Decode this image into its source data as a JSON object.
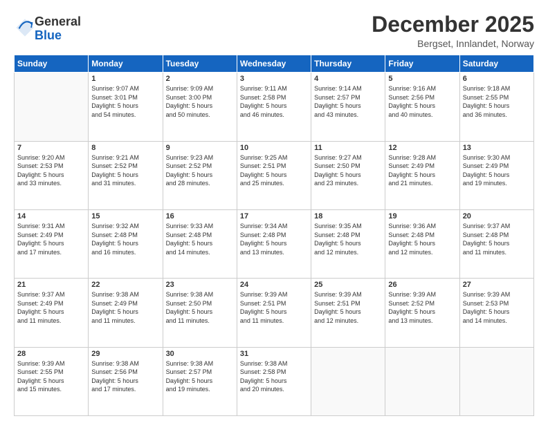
{
  "logo": {
    "general": "General",
    "blue": "Blue"
  },
  "title": "December 2025",
  "location": "Bergset, Innlandet, Norway",
  "headers": [
    "Sunday",
    "Monday",
    "Tuesday",
    "Wednesday",
    "Thursday",
    "Friday",
    "Saturday"
  ],
  "weeks": [
    [
      {
        "day": "",
        "info": ""
      },
      {
        "day": "1",
        "info": "Sunrise: 9:07 AM\nSunset: 3:01 PM\nDaylight: 5 hours\nand 54 minutes."
      },
      {
        "day": "2",
        "info": "Sunrise: 9:09 AM\nSunset: 3:00 PM\nDaylight: 5 hours\nand 50 minutes."
      },
      {
        "day": "3",
        "info": "Sunrise: 9:11 AM\nSunset: 2:58 PM\nDaylight: 5 hours\nand 46 minutes."
      },
      {
        "day": "4",
        "info": "Sunrise: 9:14 AM\nSunset: 2:57 PM\nDaylight: 5 hours\nand 43 minutes."
      },
      {
        "day": "5",
        "info": "Sunrise: 9:16 AM\nSunset: 2:56 PM\nDaylight: 5 hours\nand 40 minutes."
      },
      {
        "day": "6",
        "info": "Sunrise: 9:18 AM\nSunset: 2:55 PM\nDaylight: 5 hours\nand 36 minutes."
      }
    ],
    [
      {
        "day": "7",
        "info": "Sunrise: 9:20 AM\nSunset: 2:53 PM\nDaylight: 5 hours\nand 33 minutes."
      },
      {
        "day": "8",
        "info": "Sunrise: 9:21 AM\nSunset: 2:52 PM\nDaylight: 5 hours\nand 31 minutes."
      },
      {
        "day": "9",
        "info": "Sunrise: 9:23 AM\nSunset: 2:52 PM\nDaylight: 5 hours\nand 28 minutes."
      },
      {
        "day": "10",
        "info": "Sunrise: 9:25 AM\nSunset: 2:51 PM\nDaylight: 5 hours\nand 25 minutes."
      },
      {
        "day": "11",
        "info": "Sunrise: 9:27 AM\nSunset: 2:50 PM\nDaylight: 5 hours\nand 23 minutes."
      },
      {
        "day": "12",
        "info": "Sunrise: 9:28 AM\nSunset: 2:49 PM\nDaylight: 5 hours\nand 21 minutes."
      },
      {
        "day": "13",
        "info": "Sunrise: 9:30 AM\nSunset: 2:49 PM\nDaylight: 5 hours\nand 19 minutes."
      }
    ],
    [
      {
        "day": "14",
        "info": "Sunrise: 9:31 AM\nSunset: 2:49 PM\nDaylight: 5 hours\nand 17 minutes."
      },
      {
        "day": "15",
        "info": "Sunrise: 9:32 AM\nSunset: 2:48 PM\nDaylight: 5 hours\nand 16 minutes."
      },
      {
        "day": "16",
        "info": "Sunrise: 9:33 AM\nSunset: 2:48 PM\nDaylight: 5 hours\nand 14 minutes."
      },
      {
        "day": "17",
        "info": "Sunrise: 9:34 AM\nSunset: 2:48 PM\nDaylight: 5 hours\nand 13 minutes."
      },
      {
        "day": "18",
        "info": "Sunrise: 9:35 AM\nSunset: 2:48 PM\nDaylight: 5 hours\nand 12 minutes."
      },
      {
        "day": "19",
        "info": "Sunrise: 9:36 AM\nSunset: 2:48 PM\nDaylight: 5 hours\nand 12 minutes."
      },
      {
        "day": "20",
        "info": "Sunrise: 9:37 AM\nSunset: 2:48 PM\nDaylight: 5 hours\nand 11 minutes."
      }
    ],
    [
      {
        "day": "21",
        "info": "Sunrise: 9:37 AM\nSunset: 2:49 PM\nDaylight: 5 hours\nand 11 minutes."
      },
      {
        "day": "22",
        "info": "Sunrise: 9:38 AM\nSunset: 2:49 PM\nDaylight: 5 hours\nand 11 minutes."
      },
      {
        "day": "23",
        "info": "Sunrise: 9:38 AM\nSunset: 2:50 PM\nDaylight: 5 hours\nand 11 minutes."
      },
      {
        "day": "24",
        "info": "Sunrise: 9:39 AM\nSunset: 2:51 PM\nDaylight: 5 hours\nand 11 minutes."
      },
      {
        "day": "25",
        "info": "Sunrise: 9:39 AM\nSunset: 2:51 PM\nDaylight: 5 hours\nand 12 minutes."
      },
      {
        "day": "26",
        "info": "Sunrise: 9:39 AM\nSunset: 2:52 PM\nDaylight: 5 hours\nand 13 minutes."
      },
      {
        "day": "27",
        "info": "Sunrise: 9:39 AM\nSunset: 2:53 PM\nDaylight: 5 hours\nand 14 minutes."
      }
    ],
    [
      {
        "day": "28",
        "info": "Sunrise: 9:39 AM\nSunset: 2:55 PM\nDaylight: 5 hours\nand 15 minutes."
      },
      {
        "day": "29",
        "info": "Sunrise: 9:38 AM\nSunset: 2:56 PM\nDaylight: 5 hours\nand 17 minutes."
      },
      {
        "day": "30",
        "info": "Sunrise: 9:38 AM\nSunset: 2:57 PM\nDaylight: 5 hours\nand 19 minutes."
      },
      {
        "day": "31",
        "info": "Sunrise: 9:38 AM\nSunset: 2:58 PM\nDaylight: 5 hours\nand 20 minutes."
      },
      {
        "day": "",
        "info": ""
      },
      {
        "day": "",
        "info": ""
      },
      {
        "day": "",
        "info": ""
      }
    ]
  ]
}
